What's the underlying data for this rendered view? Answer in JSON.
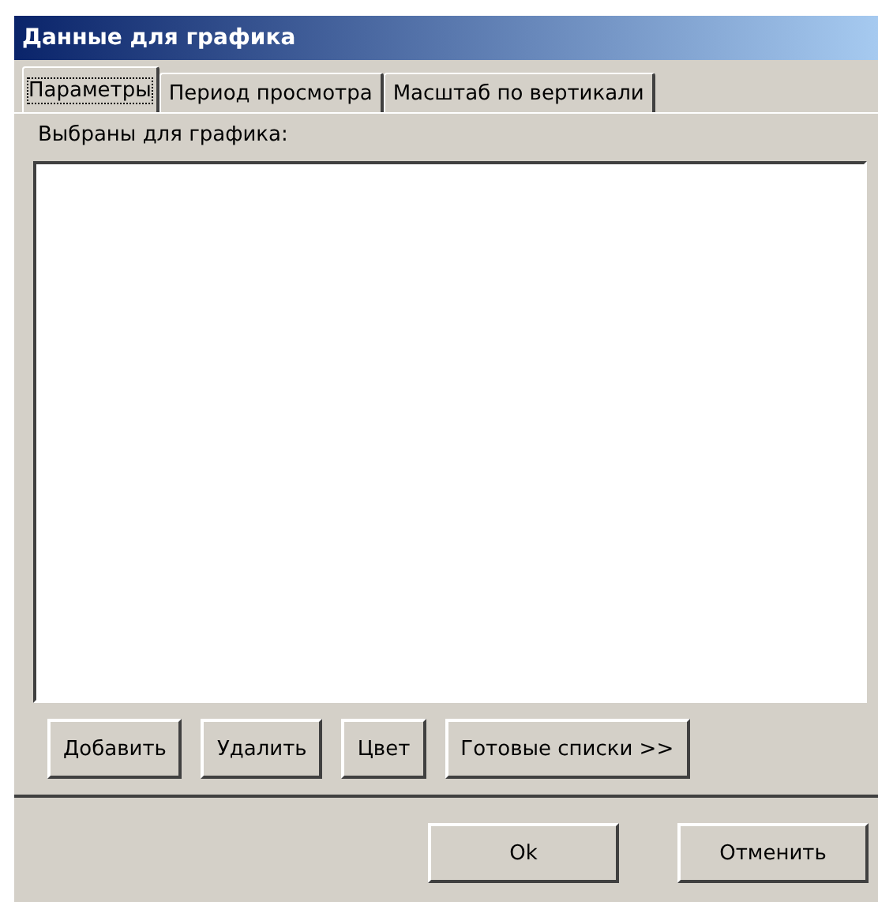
{
  "window": {
    "title": "Данные для графика"
  },
  "tabs": [
    {
      "label": "Параметры",
      "selected": true
    },
    {
      "label": "Период просмотра",
      "selected": false
    },
    {
      "label": "Масштаб по вертикали",
      "selected": false
    }
  ],
  "list": {
    "label": "Выбраны для графика:"
  },
  "list_buttons": [
    "Добавить",
    "Удалить",
    "Цвет",
    "Готовые списки >>"
  ],
  "dialog_buttons": [
    "Ok",
    "Отменить"
  ]
}
